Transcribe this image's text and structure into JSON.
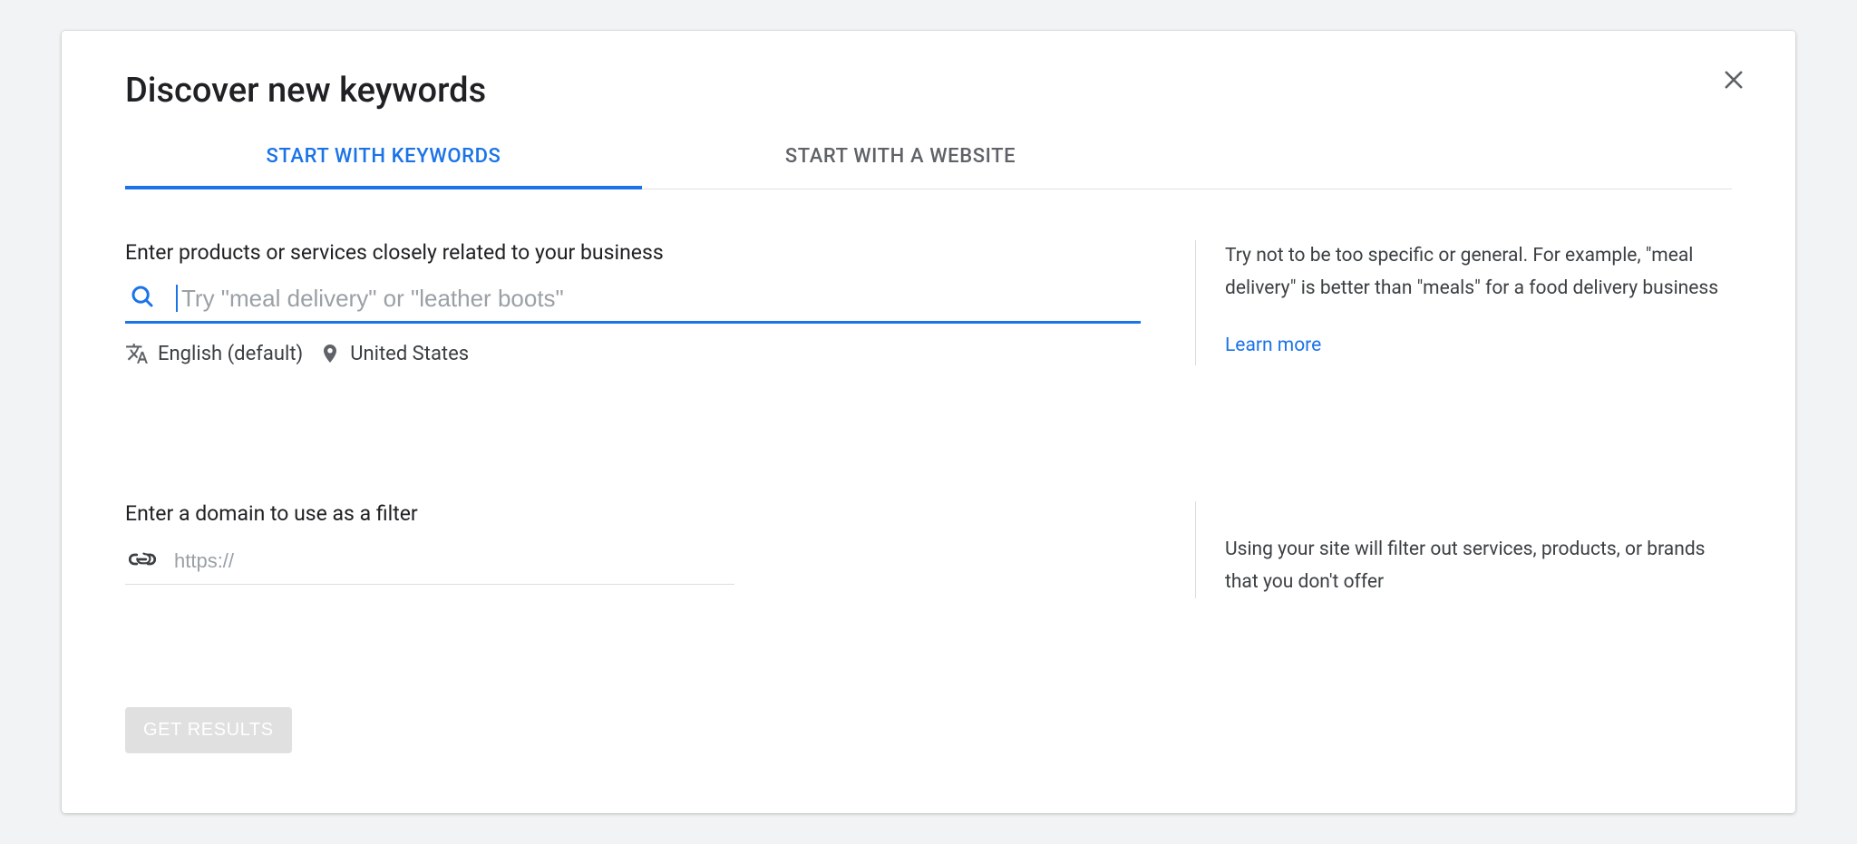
{
  "title": "Discover new keywords",
  "tabs": {
    "keywords": "START WITH KEYWORDS",
    "website": "START WITH A WEBSITE"
  },
  "keywords_section": {
    "label": "Enter products or services closely related to your business",
    "placeholder": "Try \"meal delivery\" or \"leather boots\"",
    "language": "English (default)",
    "location": "United States",
    "tip": "Try not to be too specific or general. For example, \"meal delivery\" is better than \"meals\" for a food delivery business",
    "learn_more": "Learn more"
  },
  "domain_section": {
    "label": "Enter a domain to use as a filter",
    "placeholder": "https://",
    "tip": "Using your site will filter out services, products, or brands that you don't offer"
  },
  "buttons": {
    "get_results": "GET RESULTS"
  }
}
